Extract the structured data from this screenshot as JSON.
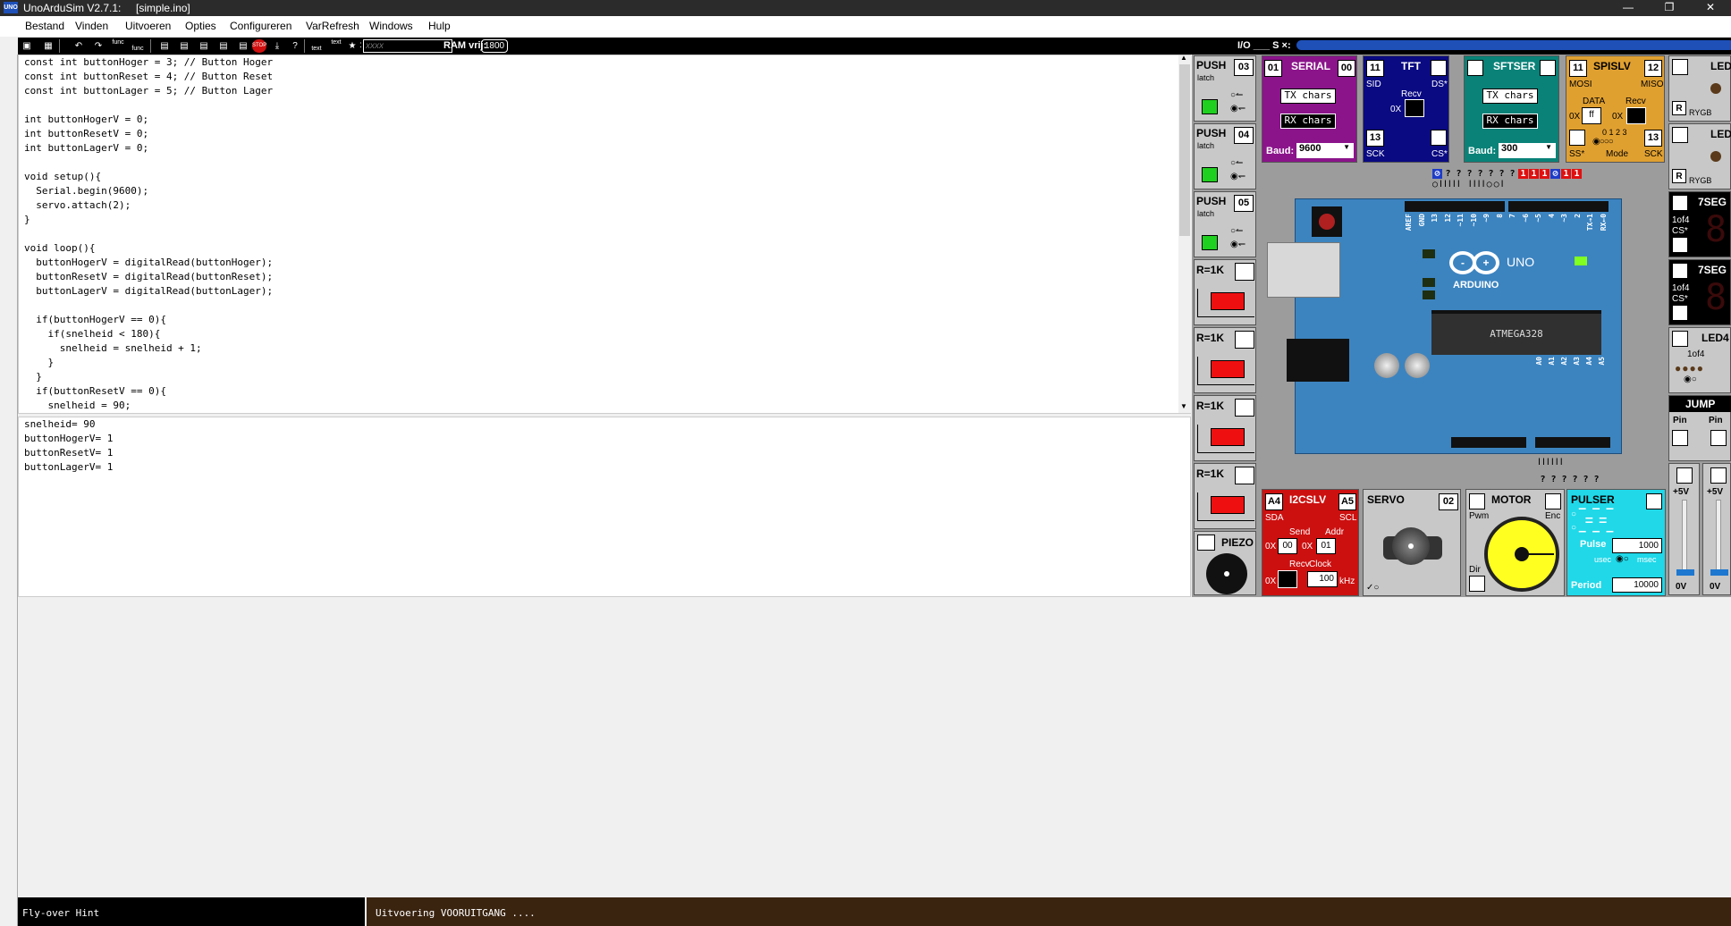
{
  "window": {
    "title": "UnoArduSim V2.7.1:     [simple.ino]",
    "logo": "UNO"
  },
  "menu": [
    "Bestand",
    "Vinden",
    "Uitvoeren",
    "Opties",
    "Configureren",
    "VarRefresh",
    "Windows",
    "Hulp"
  ],
  "toolbar": {
    "func_labels": [
      "func",
      "func"
    ],
    "text_labels": [
      "text",
      "text"
    ],
    "search_placeholder": "xxxx",
    "ram_label": "RAM vrij:",
    "ram_value": "1800",
    "io_label": "I/O ___ S ×:"
  },
  "editor_lines": [
    "const int buttonHoger = 3; // Button Hoger",
    "const int buttonReset = 4; // Button Reset",
    "const int buttonLager = 5; // Button Lager",
    "",
    "int buttonHogerV = 0;",
    "int buttonResetV = 0;",
    "int buttonLagerV = 0;",
    "",
    "void setup(){",
    "  Serial.begin(9600);",
    "  servo.attach(2);",
    "}",
    "",
    "void loop(){",
    "  buttonHogerV = digitalRead(buttonHoger);",
    "  buttonResetV = digitalRead(buttonReset);",
    "  buttonLagerV = digitalRead(buttonLager);",
    "",
    "  if(buttonHogerV == 0){",
    "    if(snelheid < 180){",
    "      snelheid = snelheid + 1;",
    "    }",
    "  }",
    "  if(buttonResetV == 0){",
    "    snelheid = 90;"
  ],
  "variables": [
    "snelheid= 90",
    "buttonHogerV= 1",
    "buttonResetV= 1",
    "buttonLagerV= 1"
  ],
  "push_buttons": [
    {
      "label": "PUSH",
      "pin": "03",
      "latch": "latch"
    },
    {
      "label": "PUSH",
      "pin": "04",
      "latch": "latch"
    },
    {
      "label": "PUSH",
      "pin": "05",
      "latch": "latch"
    }
  ],
  "resistors": [
    {
      "label": "R=1K"
    },
    {
      "label": "R=1K"
    },
    {
      "label": "R=1K"
    },
    {
      "label": "R=1K"
    }
  ],
  "piezo": {
    "label": "PIEZO"
  },
  "serial": {
    "label": "SERIAL",
    "pin_left": "01",
    "pin_right": "00",
    "tx": "TX chars",
    "rx": "RX chars",
    "baud_label": "Baud:",
    "baud": "9600"
  },
  "tft": {
    "label": "TFT",
    "pin": "11",
    "sid": "SID",
    "ds": "DS*",
    "recv": "Recv",
    "ox": "0X",
    "sck_pin": "13",
    "sck": "SCK",
    "cs": "CS*"
  },
  "sftser": {
    "label": "SFTSER",
    "tx": "TX chars",
    "rx": "RX chars",
    "baud_label": "Baud:",
    "baud": "300"
  },
  "spislv": {
    "label": "SPISLV",
    "pin_left": "11",
    "pin_right": "12",
    "mosi": "MOSI",
    "miso": "MISO",
    "data": "DATA",
    "recv": "Recv",
    "ox1": "0X",
    "data_val": "ff",
    "ox2": "0X",
    "ss": "SS*",
    "mode_nums": "0 1 2 3",
    "mode": "Mode",
    "sck_pin": "13",
    "sck": "SCK"
  },
  "pin_states_top": [
    "⊘",
    "?",
    "?",
    "?",
    "?",
    "?",
    "?",
    "?",
    "1",
    "1",
    "1",
    "⊘",
    "1",
    "1"
  ],
  "pin_states_bottom": [
    "?",
    "?",
    "?",
    "?",
    "?",
    "?"
  ],
  "board": {
    "brand": "ARDUINO",
    "model": "UNO",
    "chip": "ATMEGA328",
    "header_labels": [
      "AREF",
      "GND",
      "13",
      "12",
      "~11",
      "~10",
      "~9",
      "8",
      "7",
      "~6",
      "~5",
      "4",
      "~3",
      "2",
      "TX→1",
      "RX←0"
    ],
    "analog_labels": [
      "A0",
      "A1",
      "A2",
      "A3",
      "A4",
      "A5"
    ]
  },
  "i2cslv": {
    "label": "I2CSLV",
    "pin_left": "A4",
    "pin_right": "A5",
    "sda": "SDA",
    "scl": "SCL",
    "send": "Send",
    "addr": "Addr",
    "ox": "0X",
    "send_val": "00",
    "addr_val": "01",
    "recv": "Recv",
    "clock": "Clock",
    "clock_val": "100",
    "khz": "kHz"
  },
  "servo": {
    "label": "SERVO",
    "pin": "02"
  },
  "motor": {
    "label": "MOTOR",
    "pwm": "Pwm",
    "enc": "Enc",
    "dir": "Dir"
  },
  "pulser": {
    "label": "PULSER",
    "pulse": "Pulse",
    "pulse_val": "1000",
    "usec": "usec",
    "msec": "msec",
    "period": "Period",
    "period_val": "10000"
  },
  "leds": [
    {
      "label": "LED",
      "r": "R",
      "rygb": "RYGB"
    },
    {
      "label": "LED",
      "r": "R",
      "rygb": "RYGB"
    }
  ],
  "sevenseg": [
    {
      "label": "7SEG",
      "of": "1of4",
      "cs": "CS*"
    },
    {
      "label": "7SEG",
      "of": "1of4",
      "cs": "CS*"
    }
  ],
  "led4": {
    "label": "LED4",
    "of": "1of4"
  },
  "jump": {
    "label": "JUMP",
    "pin1": "Pin",
    "pin2": "Pin"
  },
  "pots": [
    {
      "top": "+5V",
      "bottom": "0V"
    },
    {
      "top": "+5V",
      "bottom": "0V"
    }
  ],
  "status": {
    "hint": "Fly-over Hint",
    "progress": "Uitvoering VOORUITGANG ...."
  },
  "colors": {
    "serial": "#8b148b",
    "tft": "#0a0a82",
    "sftser": "#0a8278",
    "spislv": "#e0a030",
    "i2cslv": "#cc1010",
    "pulser": "#20d8e8",
    "board": "#3c84c0"
  }
}
